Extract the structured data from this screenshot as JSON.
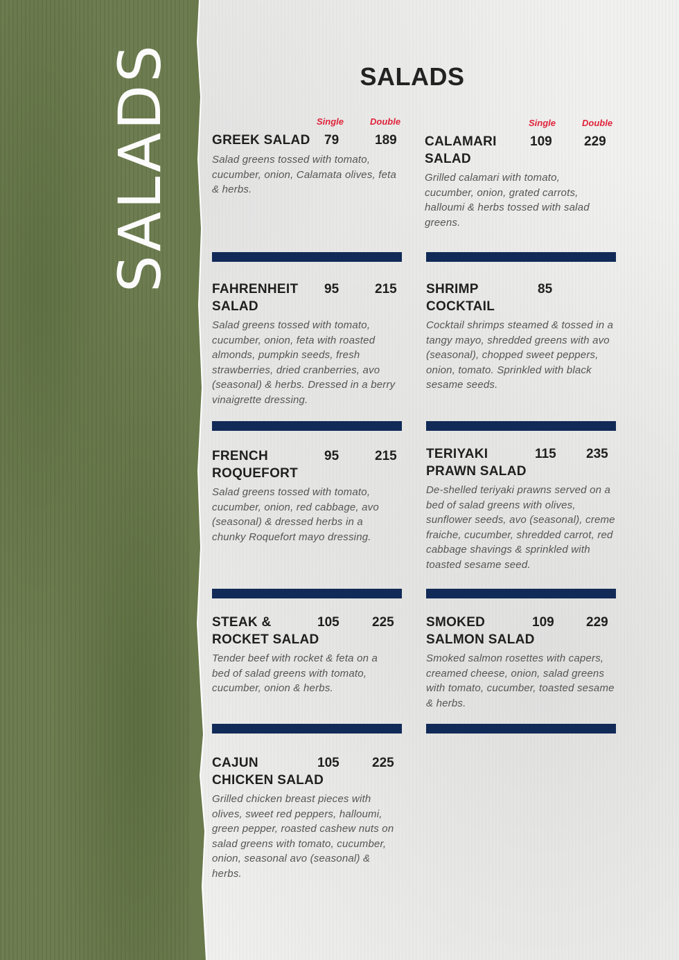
{
  "side_title": "SALADS",
  "page_title": "SALADS",
  "price_labels": {
    "single": "Single",
    "double": "Double"
  },
  "items": {
    "greek": {
      "name": "GREEK SALAD",
      "single": "79",
      "double": "189",
      "desc": "Salad greens tossed with tomato, cucumber, onion, Calamata olives, feta & herbs."
    },
    "calamari": {
      "name_1": "CALAMARI",
      "name_2": "SALAD",
      "single": "109",
      "double": "229",
      "desc": "Grilled calamari with tomato, cucumber, onion, grated carrots, halloumi & herbs tossed with salad greens."
    },
    "fahrenheit": {
      "name_1": "FAHRENHEIT",
      "name_2": "SALAD",
      "single": "95",
      "double": "215",
      "desc": "Salad greens tossed with tomato, cucumber, onion, feta with roasted almonds, pumpkin seeds, fresh strawberries, dried cranberries, avo (seasonal) & herbs. Dressed in a berry vinaigrette dressing."
    },
    "shrimp": {
      "name_1": "SHRIMP",
      "name_2": "COCKTAIL",
      "single": "85",
      "desc": "Cocktail shrimps steamed & tossed in a tangy mayo, shredded greens with avo (seasonal), chopped sweet peppers, onion, tomato. Sprinkled with black sesame seeds."
    },
    "french": {
      "name_1": "FRENCH",
      "name_2": "ROQUEFORT",
      "single": "95",
      "double": "215",
      "desc": "Salad greens tossed with tomato, cucumber, onion, red cabbage, avo (seasonal) & dressed herbs in a chunky Roquefort mayo dressing."
    },
    "teriyaki": {
      "name_1": "TERIYAKI",
      "name_2": "PRAWN SALAD",
      "single": "115",
      "double": "235",
      "desc": "De-shelled teriyaki prawns served on a bed of salad greens with olives, sunflower seeds, avo (seasonal), creme fraiche, cucumber, shredded carrot, red cabbage shavings & sprinkled with toasted sesame seed."
    },
    "steak": {
      "name_1": "STEAK &",
      "name_2": "ROCKET SALAD",
      "single": "105",
      "double": "225",
      "desc": "Tender beef with rocket & feta on a bed of salad greens with tomato, cucumber, onion & herbs."
    },
    "salmon": {
      "name_1": "SMOKED",
      "name_2": "SALMON SALAD",
      "single": "109",
      "double": "229",
      "desc": "Smoked salmon rosettes with capers, creamed cheese, onion, salad greens with tomato, cucumber, toasted sesame & herbs."
    },
    "cajun": {
      "name_1": "CAJUN",
      "name_2": "CHICKEN SALAD",
      "single": "105",
      "double": "225",
      "desc": "Grilled chicken breast pieces with olives, sweet red peppers, halloumi, green pepper, roasted cashew nuts on salad greens with tomato, cucumber, onion, seasonal avo (seasonal) & herbs."
    }
  },
  "colors": {
    "sidebar": "#6a7a4c",
    "divider": "#112a57",
    "price_label": "#e0233a",
    "text": "#1f1f1f"
  }
}
